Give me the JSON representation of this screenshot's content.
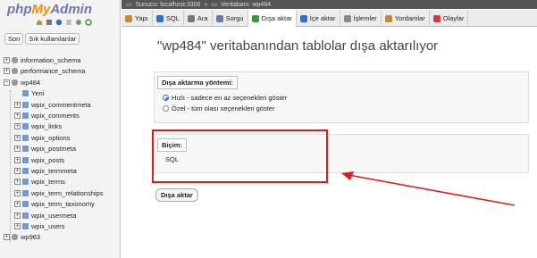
{
  "sidebar": {
    "logo": {
      "php": "php",
      "my": "My",
      "admin": "Admin"
    },
    "quick_icons": [
      "home-icon",
      "exit-icon",
      "help-icon",
      "docs-icon",
      "settings-icon",
      "reload-icon"
    ],
    "top_buttons": [
      "Son",
      "Sık kullanılanlar"
    ],
    "databases": [
      {
        "name": "information_schema",
        "expanded": false
      },
      {
        "name": "performance_schema",
        "expanded": false
      },
      {
        "name": "wp484",
        "expanded": true
      },
      {
        "name": "Yeni",
        "child": true
      },
      {
        "name": "wpix_commentmeta",
        "child": true
      },
      {
        "name": "wpix_comments",
        "child": true
      },
      {
        "name": "wpix_links",
        "child": true
      },
      {
        "name": "wpix_options",
        "child": true
      },
      {
        "name": "wpix_postmeta",
        "child": true
      },
      {
        "name": "wpix_posts",
        "child": true
      },
      {
        "name": "wpix_termmeta",
        "child": true
      },
      {
        "name": "wpix_terms",
        "child": true
      },
      {
        "name": "wpix_term_relationships",
        "child": true
      },
      {
        "name": "wpix_term_taxonomy",
        "child": true
      },
      {
        "name": "wpix_usermeta",
        "child": true
      },
      {
        "name": "wpix_users",
        "child": true
      },
      {
        "name": "wp963",
        "expanded": false
      }
    ]
  },
  "breadcrumb": {
    "server": "Sunucu: localhost:3306",
    "sep": "»",
    "db": "Veritabanı: wp484"
  },
  "tabs": [
    {
      "label": "Yapı",
      "icon": "structure-icon"
    },
    {
      "label": "SQL",
      "icon": "sql-icon"
    },
    {
      "label": "Ara",
      "icon": "search-icon"
    },
    {
      "label": "Sorgu",
      "icon": "query-icon"
    },
    {
      "label": "Dışa aktar",
      "icon": "export-icon",
      "active": true
    },
    {
      "label": "İçe aktar",
      "icon": "import-icon"
    },
    {
      "label": "İşlemler",
      "icon": "wrench-icon"
    },
    {
      "label": "Yordamlar",
      "icon": "routines-icon"
    },
    {
      "label": "Olaylar",
      "icon": "events-icon"
    }
  ],
  "main": {
    "title": "\"wp484\" veritabanından tablolar dışa aktarılıyor",
    "method": {
      "legend": "Dışa aktarma yöntemi:",
      "options": [
        {
          "label": "Hızlı - sadece en az seçenekleri göster",
          "checked": true
        },
        {
          "label": "Özel - tüm olası seçenekleri göster",
          "checked": false
        }
      ]
    },
    "format": {
      "legend": "Biçim:",
      "value": "SQL"
    },
    "submit_label": "Dışa aktar"
  },
  "colors": {
    "accent": "#2a6ed6",
    "annotation": "#e21b1b",
    "logo_blue": "#6c78af",
    "logo_orange": "#f29111"
  }
}
